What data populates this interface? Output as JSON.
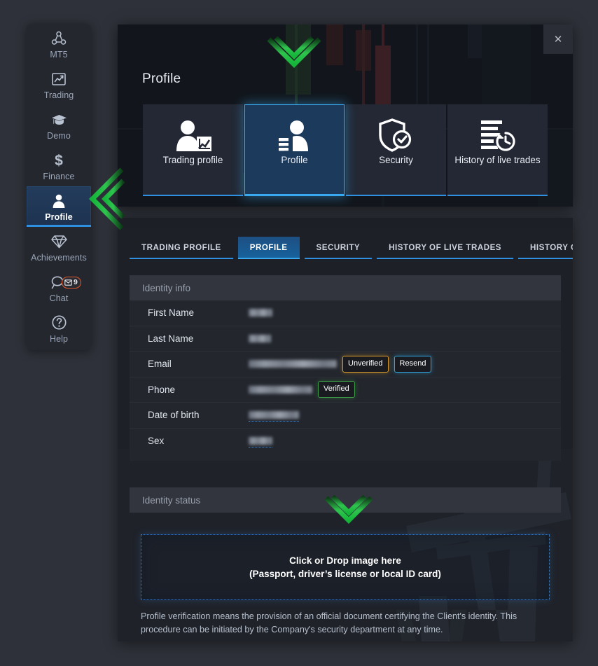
{
  "theme": {
    "page_bg": "#2e3139",
    "panel_bg": "#1f2229",
    "modal_bg": "#12161c",
    "accent_blue": "#2f8fe0",
    "accent_blue_bright": "#38a8ef",
    "annotation_green": "#29c24a",
    "badge_orange": "#d79a2b",
    "badge_cyan": "#2fa6dd",
    "badge_green": "#3d9a46",
    "chat_badge_border": "#e0582a"
  },
  "sidebar": {
    "items": [
      {
        "label": "MT5",
        "icon": "molecule-icon",
        "active": false
      },
      {
        "label": "Trading",
        "icon": "chart-line-icon",
        "active": false
      },
      {
        "label": "Demo",
        "icon": "graduation-cap-icon",
        "active": false
      },
      {
        "label": "Finance",
        "icon": "dollar-icon",
        "active": false
      },
      {
        "label": "Profile",
        "icon": "user-icon",
        "active": true
      },
      {
        "label": "Achievements",
        "icon": "diamond-icon",
        "active": false
      },
      {
        "label": "Chat",
        "icon": "chat-bubble-icon",
        "active": false,
        "badge": "9",
        "badge_icon": "envelope-icon"
      },
      {
        "label": "Help",
        "icon": "question-circle-icon",
        "active": false
      }
    ]
  },
  "modal": {
    "title": "Profile",
    "close_label": "✕",
    "cards": [
      {
        "label": "Trading profile",
        "icon": "user-chart-icon",
        "selected": false
      },
      {
        "label": "Profile",
        "icon": "user-lines-icon",
        "selected": true
      },
      {
        "label": "Security",
        "icon": "shield-check-icon",
        "selected": false
      },
      {
        "label": "History of live trades",
        "icon": "list-clock-icon",
        "selected": false
      }
    ]
  },
  "panel": {
    "tabs": [
      {
        "label": "TRADING PROFILE",
        "active": false
      },
      {
        "label": "PROFILE",
        "active": true
      },
      {
        "label": "SECURITY",
        "active": false
      },
      {
        "label": "HISTORY OF LIVE TRADES",
        "active": false
      },
      {
        "label": "HISTORY OF DEMO TRADES",
        "active": false
      }
    ],
    "identity_info": {
      "heading": "Identity info",
      "rows": [
        {
          "label": "First Name",
          "value": "",
          "redacted_width": 34,
          "badges": []
        },
        {
          "label": "Last Name",
          "value": "",
          "redacted_width": 32,
          "badges": []
        },
        {
          "label": "Email",
          "value": "",
          "redacted_width": 126,
          "badges": [
            {
              "text": "Unverified",
              "style": "unverified"
            },
            {
              "text": "Resend",
              "style": "resend"
            }
          ]
        },
        {
          "label": "Phone",
          "value": "",
          "redacted_width": 91,
          "badges": [
            {
              "text": "Verified",
              "style": "verified"
            }
          ]
        },
        {
          "label": "Date of birth",
          "value": "",
          "redacted_width": 72,
          "badges": [],
          "editable_underline": true
        },
        {
          "label": "Sex",
          "value": "",
          "redacted_width": 34,
          "badges": [],
          "editable_underline": true
        }
      ]
    },
    "identity_status": {
      "heading": "Identity status",
      "dropzone_line1": "Click or Drop image here",
      "dropzone_line2": "(Passport, driver’s license or local ID card)",
      "note": "Profile verification means the provision of an official document certifying the Client's identity. This procedure can be initiated by the Company's security department at any time."
    }
  },
  "annotations": [
    {
      "name": "chevron-pointing-to-profile-card",
      "direction": "down"
    },
    {
      "name": "chevron-pointing-to-sidebar-profile",
      "direction": "left"
    },
    {
      "name": "chevron-pointing-to-dropzone",
      "direction": "down"
    }
  ]
}
